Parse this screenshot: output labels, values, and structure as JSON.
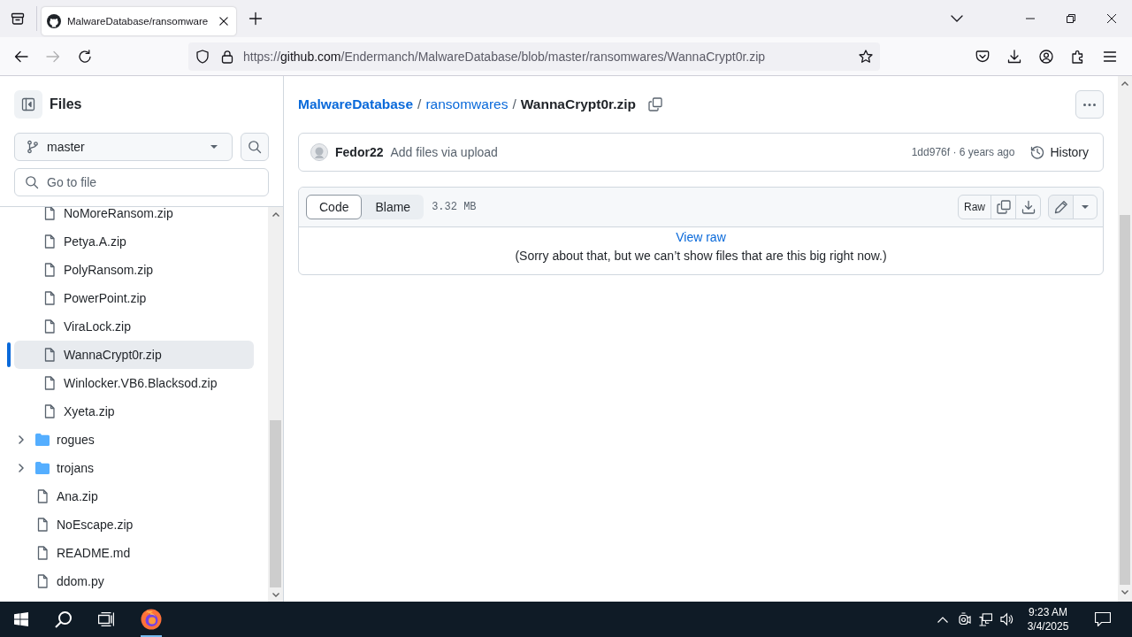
{
  "browser": {
    "tabs": [
      {
        "title": "MalwareDatabase/ransomware",
        "selected": true
      }
    ],
    "nav": {
      "back": {
        "disabled": false
      },
      "forward": {
        "disabled": true
      },
      "reload": {
        "disabled": false
      }
    },
    "url": {
      "scheme": "https://",
      "host": "github.com",
      "path": "/Endermanch/MalwareDatabase/blob/master/ransomwares/WannaCrypt0r.zip"
    }
  },
  "sidebar": {
    "title": "Files",
    "branch": "master",
    "search": {
      "placeholder": "Go to file"
    },
    "tree": [
      {
        "kind": "folder",
        "expanded": true,
        "children": [
          {
            "kind": "file",
            "name": "NoMoreRansom.zip",
            "selected": false
          },
          {
            "kind": "file",
            "name": "Petya.A.zip",
            "selected": false
          },
          {
            "kind": "file",
            "name": "PolyRansom.zip",
            "selected": false
          },
          {
            "kind": "file",
            "name": "PowerPoint.zip",
            "selected": false
          },
          {
            "kind": "file",
            "name": "ViraLock.zip",
            "selected": false
          },
          {
            "kind": "file",
            "name": "WannaCrypt0r.zip",
            "selected": true
          },
          {
            "kind": "file",
            "name": "Winlocker.VB6.Blacksod.zip",
            "selected": false
          },
          {
            "kind": "file",
            "name": "Xyeta.zip",
            "selected": false
          }
        ]
      },
      {
        "kind": "folder",
        "name": "rogues",
        "expanded": false,
        "selected": false
      },
      {
        "kind": "folder",
        "name": "trojans",
        "expanded": false,
        "selected": false
      },
      {
        "kind": "file",
        "name": "Ana.zip",
        "selected": false
      },
      {
        "kind": "file",
        "name": "NoEscape.zip",
        "selected": false
      },
      {
        "kind": "file",
        "name": "README.md",
        "selected": false
      },
      {
        "kind": "file",
        "name": "ddom.py",
        "selected": false
      }
    ]
  },
  "file": {
    "breadcrumb": [
      {
        "kind": "repo",
        "label": "MalwareDatabase"
      },
      {
        "kind": "separator",
        "label": "/"
      },
      {
        "kind": "dir",
        "label": "ransomwares"
      },
      {
        "kind": "separator",
        "label": "/"
      },
      {
        "kind": "file",
        "label": "WannaCrypt0r.zip"
      }
    ],
    "commit": {
      "author": "Fedor22",
      "message": "Add files via upload",
      "meta": "1dd976f · 6 years ago",
      "history": "History"
    },
    "view_tabs": [
      {
        "label": "Code",
        "selected": true
      },
      {
        "label": "Blame",
        "selected": false
      }
    ],
    "size": "3.32 MB",
    "raw": "Raw",
    "link": "View raw",
    "notice": "(Sorry about that, but we can’t show files that are this big right now.)"
  },
  "taskbar": {
    "browser": {
      "running": true
    },
    "clock": {
      "time": "9:23 AM",
      "date": "3/4/2025"
    }
  }
}
